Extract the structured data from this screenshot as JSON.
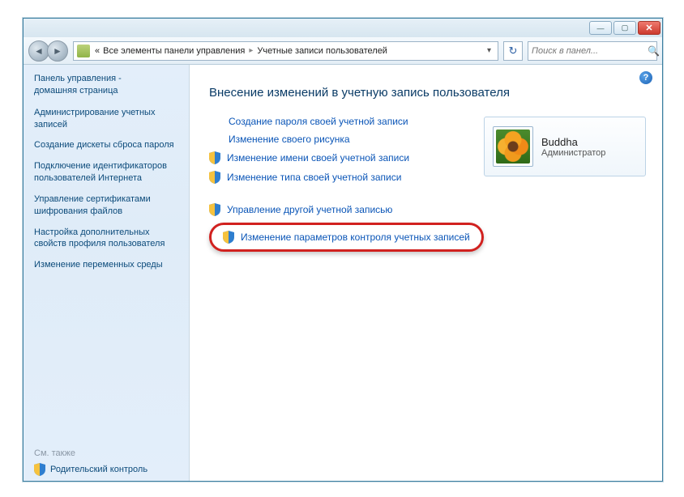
{
  "titlebar": {
    "min": "—",
    "max": "▢",
    "close": "✕"
  },
  "breadcrumb": {
    "prefix": "«",
    "part1": "Все элементы панели управления",
    "part2": "Учетные записи пользователей"
  },
  "search": {
    "placeholder": "Поиск в панел..."
  },
  "sidebar": {
    "head1": "Панель управления -",
    "head2": "домашняя страница",
    "links": [
      "Администрирование учетных записей",
      "Создание дискеты сброса пароля",
      "Подключение идентификаторов пользователей Интернета",
      "Управление сертификатами шифрования файлов",
      "Настройка дополнительных свойств профиля пользователя",
      "Изменение переменных среды"
    ],
    "see_also": "См. также",
    "parental": "Родительский контроль"
  },
  "content": {
    "heading": "Внесение изменений в учетную запись пользователя",
    "links_plain": [
      "Создание пароля своей учетной записи",
      "Изменение своего рисунка"
    ],
    "links_shield": [
      "Изменение имени своей учетной записи",
      "Изменение типа своей учетной записи"
    ],
    "links_shield2": [
      "Управление другой учетной записью",
      "Изменение параметров контроля учетных записей"
    ]
  },
  "account": {
    "name": "Buddha",
    "role": "Администратор"
  }
}
